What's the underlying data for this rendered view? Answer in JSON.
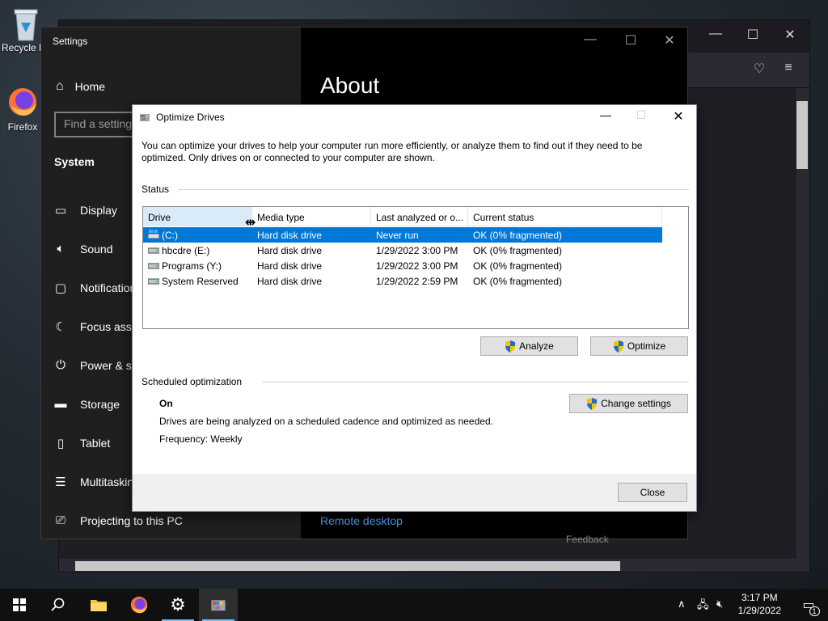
{
  "desktop": {
    "icons": [
      {
        "label": "Recycle Bin"
      },
      {
        "label": "Firefox"
      }
    ]
  },
  "settings": {
    "title": "Settings",
    "home_label": "Home",
    "search_placeholder": "Find a setting",
    "section": "System",
    "items": [
      {
        "label": "Display",
        "icon": "display-icon"
      },
      {
        "label": "Sound",
        "icon": "sound-icon"
      },
      {
        "label": "Notifications & actions",
        "icon": "notifications-icon"
      },
      {
        "label": "Focus assist",
        "icon": "focus-assist-icon"
      },
      {
        "label": "Power & sleep",
        "icon": "power-icon"
      },
      {
        "label": "Storage",
        "icon": "storage-icon"
      },
      {
        "label": "Tablet",
        "icon": "tablet-icon"
      },
      {
        "label": "Multitasking",
        "icon": "multitasking-icon"
      },
      {
        "label": "Projecting to this PC",
        "icon": "projecting-icon"
      }
    ],
    "main_heading": "About",
    "remote_desktop_link": "Remote desktop",
    "feedback": "Feedback"
  },
  "dialog": {
    "title": "Optimize Drives",
    "intro": "You can optimize your drives to help your computer run more efficiently, or analyze them to find out if they need to be optimized. Only drives on or connected to your computer are shown.",
    "status_label": "Status",
    "columns": [
      "Drive",
      "Media type",
      "Last analyzed or o...",
      "Current status"
    ],
    "drives": [
      {
        "drive": "(C:)",
        "media": "Hard disk drive",
        "last": "Never run",
        "status": "OK (0% fragmented)",
        "selected": true
      },
      {
        "drive": "hbcdre (E:)",
        "media": "Hard disk drive",
        "last": "1/29/2022 3:00 PM",
        "status": "OK (0% fragmented)",
        "selected": false
      },
      {
        "drive": "Programs (Y:)",
        "media": "Hard disk drive",
        "last": "1/29/2022 3:00 PM",
        "status": "OK (0% fragmented)",
        "selected": false
      },
      {
        "drive": "System Reserved",
        "media": "Hard disk drive",
        "last": "1/29/2022 2:59 PM",
        "status": "OK (0% fragmented)",
        "selected": false
      }
    ],
    "analyze_label": "Analyze",
    "optimize_label": "Optimize",
    "scheduled_label": "Scheduled optimization",
    "schedule_state": "On",
    "schedule_desc": "Drives are being analyzed on a scheduled cadence and optimized as needed.",
    "frequency": "Frequency: Weekly",
    "change_settings_label": "Change settings",
    "close_label": "Close"
  },
  "taskbar": {
    "time": "3:17 PM",
    "date": "1/29/2022",
    "notification_count": "1"
  },
  "colors": {
    "selection": "#0078d7",
    "taskbar": "#101010",
    "link": "#4ea1f3"
  }
}
